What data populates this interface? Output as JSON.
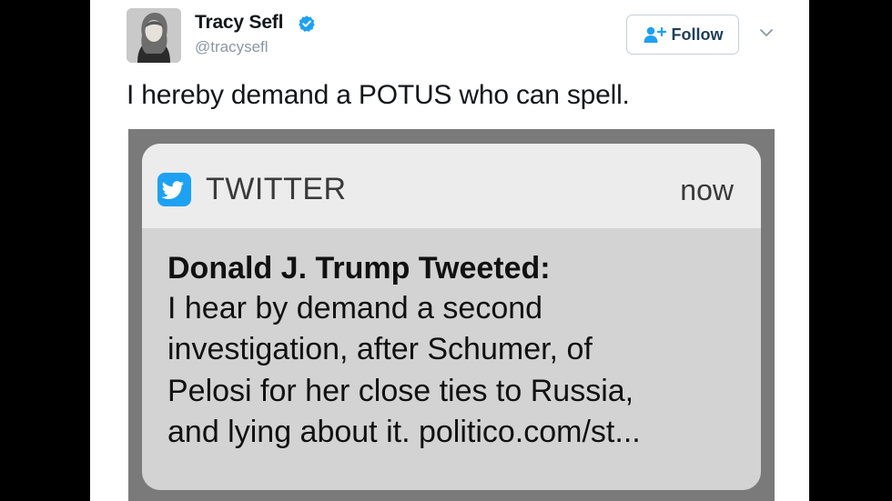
{
  "tweet": {
    "author": {
      "name": "Tracy Sefl",
      "handle": "@tracysefl",
      "verified": true,
      "avatar_icon": "profile-photo"
    },
    "follow_label": "Follow",
    "menu_icon": "chevron-down-icon",
    "text": "I hereby demand a POTUS who can spell."
  },
  "notification": {
    "app_name": "TWITTER",
    "app_icon": "twitter-bird-icon",
    "time": "now",
    "title": "Donald J. Trump Tweeted:",
    "body_lines": [
      "I hear by demand a second",
      "investigation, after Schumer, of",
      "Pelosi for her close ties to Russia,",
      "and lying about it. politico.com/st..."
    ]
  },
  "colors": {
    "twitter_blue": "#1da1f2",
    "verified_blue": "#1da1f2"
  }
}
